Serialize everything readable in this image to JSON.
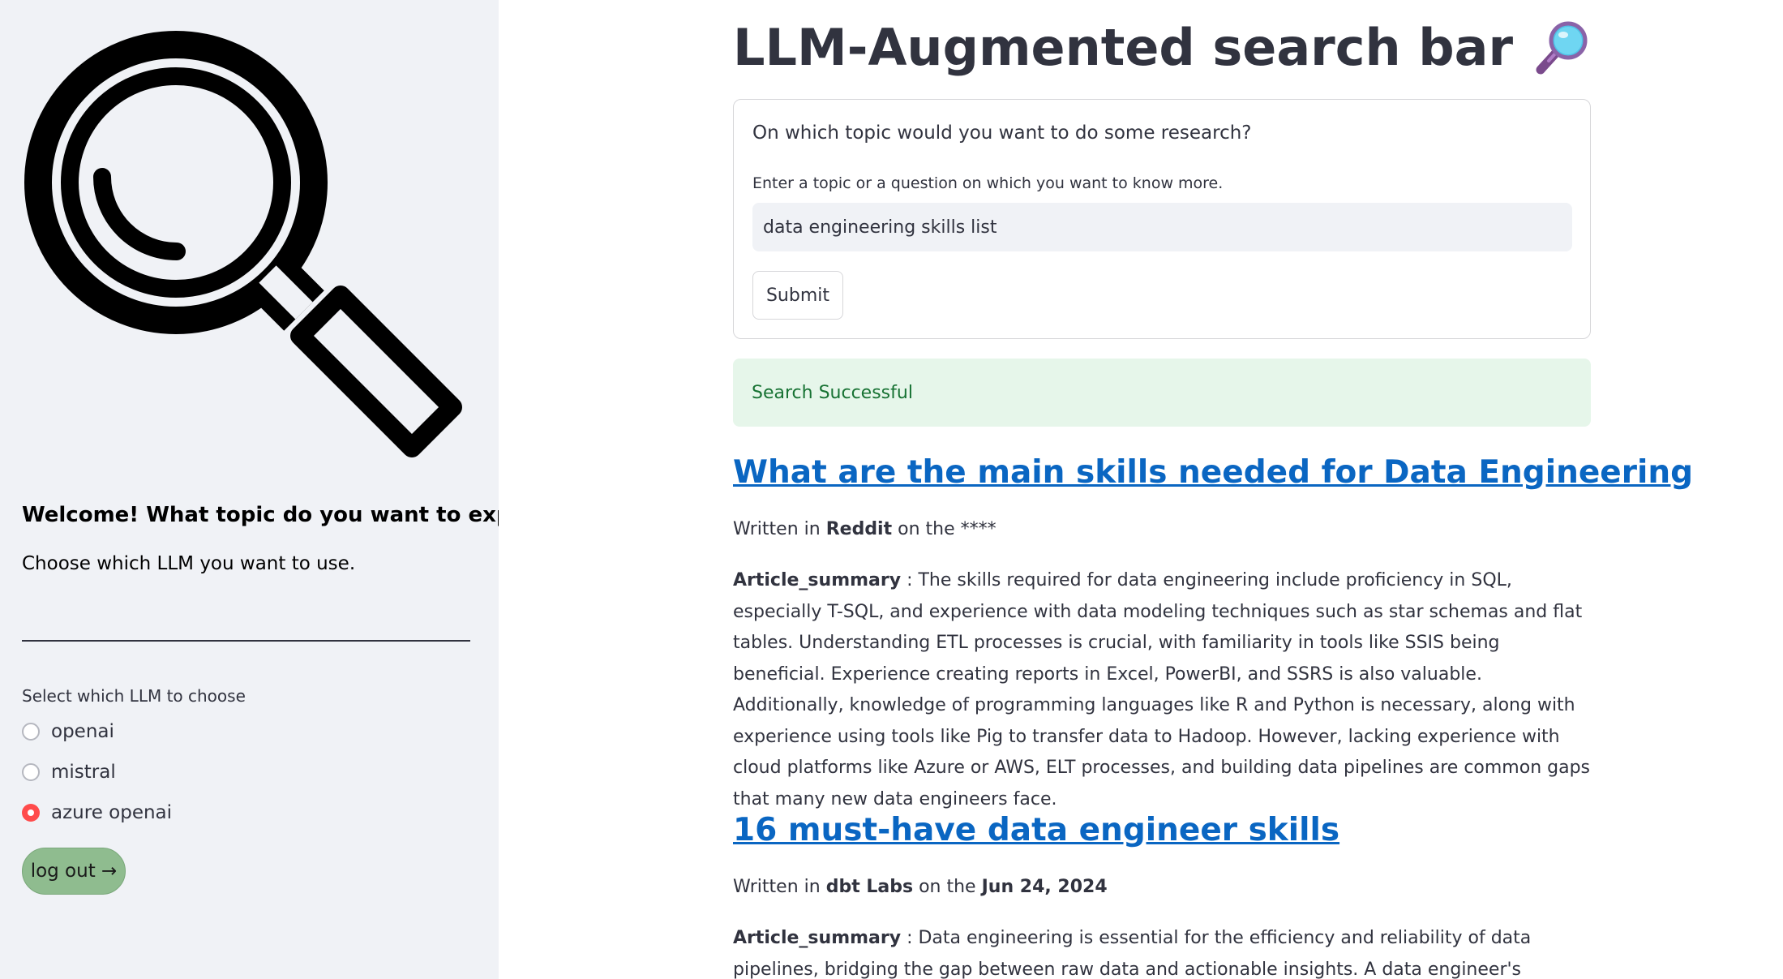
{
  "sidebar": {
    "welcome": "Welcome! What topic do you want to explore?",
    "choose_llm": "Choose which LLM you want to use.",
    "radio_label": "Select which LLM to choose",
    "options": [
      {
        "label": "openai",
        "selected": false
      },
      {
        "label": "mistral",
        "selected": false
      },
      {
        "label": "azure openai",
        "selected": true
      }
    ],
    "logout_label": "log out →",
    "logo_icon": "magnifying-glass-icon"
  },
  "main": {
    "title": "LLM-Augmented search bar",
    "title_icon": "magnifying-glass-tilted-right-emoji",
    "form": {
      "question": "On which topic would you want to do some research?",
      "hint": "Enter a topic or a question on which you want to know more.",
      "input_value": "data engineering skills list",
      "submit_label": "Submit"
    },
    "success_message": "Search Successful",
    "articles": [
      {
        "title": "What are the main skills needed for Data Engineering",
        "written_prefix": "Written in ",
        "source": "Reddit",
        "date_prefix": " on the ",
        "date": "****",
        "summary_label": "Article_summary",
        "summary_text": " : The skills required for data engineering include proficiency in SQL, especially T-SQL, and experience with data modeling techniques such as star schemas and flat tables. Understanding ETL processes is crucial, with familiarity in tools like SSIS being beneficial. Experience creating reports in Excel, PowerBI, and SSRS is also valuable. Additionally, knowledge of programming languages like R and Python is necessary, along with experience using tools like Pig to transfer data to Hadoop. However, lacking experience with cloud platforms like Azure or AWS, ELT processes, and building data pipelines are common gaps that many new data engineers face."
      },
      {
        "title": "16 must-have data engineer skills",
        "written_prefix": "Written in ",
        "source": "dbt Labs",
        "date_prefix": " on the ",
        "date": "Jun 24, 2024",
        "summary_label": "Article_summary",
        "summary_text": " : Data engineering is essential for the efficiency and reliability of data pipelines, bridging the gap between raw data and actionable insights. A data engineer's responsibilities include"
      }
    ]
  },
  "colors": {
    "sidebar_bg": "#f0f2f6",
    "accent_radio": "#ff4b4b",
    "logout_bg": "#8fbc8f",
    "link": "#0a66c2",
    "success_bg": "#e6f6ea",
    "success_text": "#177233"
  }
}
